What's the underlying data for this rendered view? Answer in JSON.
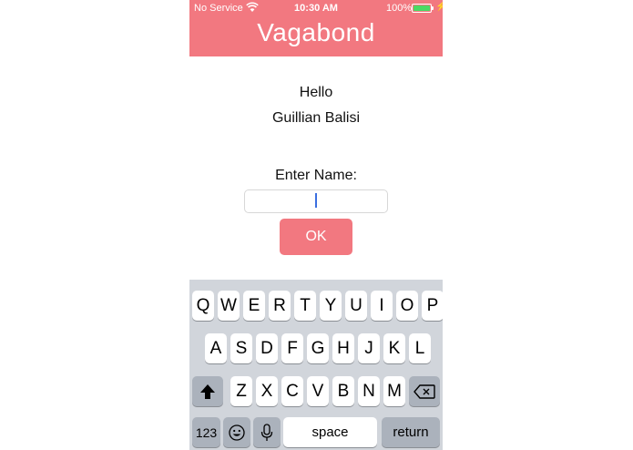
{
  "status_bar": {
    "carrier": "No Service",
    "time": "10:30 AM",
    "battery_percent": "100%",
    "battery_level": 1.0
  },
  "header": {
    "title": "Vagabond",
    "color": "#f27880"
  },
  "greeting": {
    "line1": "Hello",
    "line2": "Guillian Balisi"
  },
  "form": {
    "prompt": "Enter Name:",
    "name_value": "",
    "ok_label": "OK"
  },
  "keyboard": {
    "row1": [
      "Q",
      "W",
      "E",
      "R",
      "T",
      "Y",
      "U",
      "I",
      "O",
      "P"
    ],
    "row2": [
      "A",
      "S",
      "D",
      "F",
      "G",
      "H",
      "J",
      "K",
      "L"
    ],
    "row3": [
      "Z",
      "X",
      "C",
      "V",
      "B",
      "N",
      "M"
    ],
    "numbers_label": "123",
    "space_label": "space",
    "return_label": "return"
  }
}
